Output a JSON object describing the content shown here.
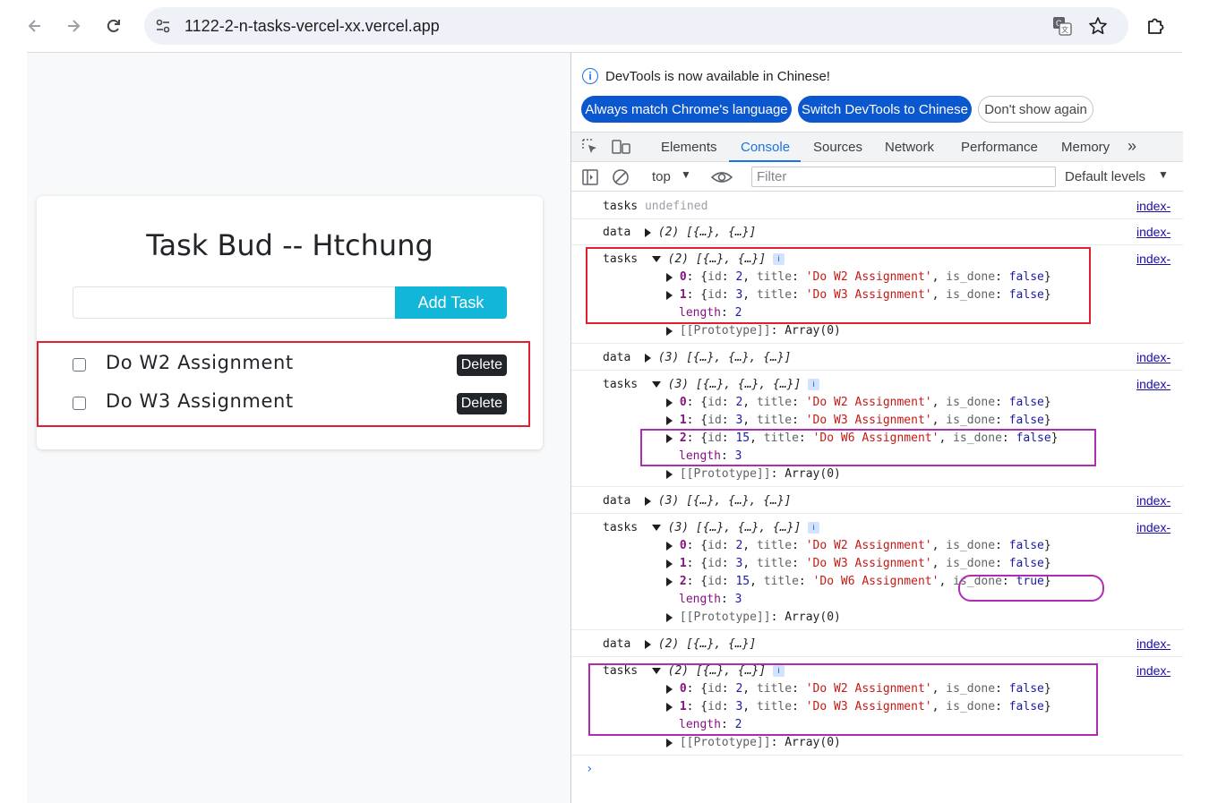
{
  "browser": {
    "url": "1122-2-n-tasks-vercel-xx.vercel.app"
  },
  "app": {
    "title": "Task Bud -- Htchung",
    "input_placeholder": "",
    "add_button": "Add Task",
    "tasks": [
      {
        "title": "Do W2 Assignment",
        "delete_label": "Delete"
      },
      {
        "title": "Do W3 Assignment",
        "delete_label": "Delete"
      }
    ]
  },
  "devtools": {
    "info_text": "DevTools is now available in Chinese!",
    "info_buttons": [
      "Always match Chrome's language",
      "Switch DevTools to Chinese",
      "Don't show again"
    ],
    "tabs": [
      "Elements",
      "Console",
      "Sources",
      "Network",
      "Performance",
      "Memory"
    ],
    "active_tab": "Console",
    "toolbar": {
      "context": "top",
      "filter_placeholder": "Filter",
      "levels": "Default levels"
    },
    "source_link": "index-",
    "console": {
      "l1_label": "tasks",
      "l1_value": "undefined",
      "data_label": "data",
      "tasks_label": "tasks",
      "d2": "(2) [{…}, {…}]",
      "d3": "(3) [{…}, {…}, {…}]",
      "t2": "(2) [{…}, {…}]",
      "t3": "(3) [{…}, {…}, {…}]",
      "id_key": "id",
      "title_key": "title",
      "done_key": "is_done",
      "w2": "'Do W2 Assignment'",
      "w3": "'Do W3 Assignment'",
      "w6": "'Do W6 Assignment'",
      "v_false": "false",
      "v_true": "true",
      "length_key": "length",
      "proto": "[[Prototype]]",
      "proto_val": "Array(0)",
      "i0": "0",
      "i1": "1",
      "i2": "2",
      "n2": "2",
      "n3": "3",
      "n15": "15"
    }
  },
  "colors": {
    "annotation_red": "#e0202e",
    "annotation_purple": "#b02cb3",
    "add_button": "#12b6d8",
    "devtools_blue": "#0b57d0"
  }
}
